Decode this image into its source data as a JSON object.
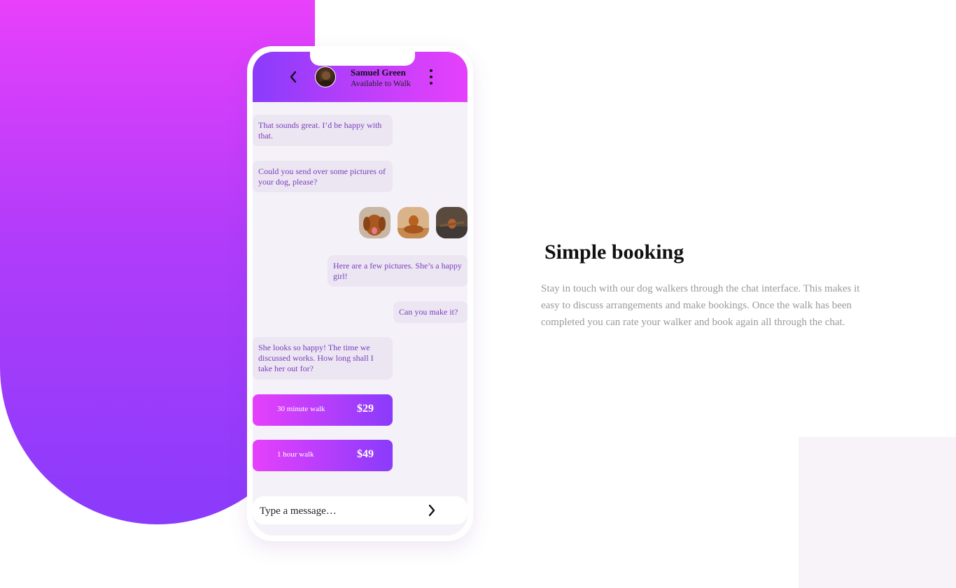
{
  "chat": {
    "contact": {
      "name": "Samuel Green",
      "status": "Available to Walk"
    },
    "messages": [
      {
        "from": "walker",
        "text": "That sounds great. I’d be happy with that."
      },
      {
        "from": "walker",
        "text": "Could you send over some pictures of your dog, please?"
      },
      {
        "from": "user",
        "type": "images",
        "count": 3
      },
      {
        "from": "user",
        "text": "Here are a few pictures. She’s a happy girl!"
      },
      {
        "from": "user",
        "text": "Can you make it?"
      },
      {
        "from": "walker",
        "text": "She looks so happy! The time we discussed works. How long shall I take her out for?"
      }
    ],
    "offers": [
      {
        "label": "30 minute walk",
        "price": "$29"
      },
      {
        "label": "1 hour walk",
        "price": "$49"
      }
    ],
    "input": {
      "placeholder": "Type a message…"
    },
    "icons": {
      "back": "chevron-left-icon",
      "more": "more-vertical-icon",
      "send": "chevron-right-icon"
    }
  },
  "feature": {
    "title": "Simple booking",
    "description": "Stay in touch with our dog walkers through the chat interface. This makes it easy to discuss arrangements and make bookings. Once the walk has been completed you can rate your walker and book again all through the chat."
  },
  "colors": {
    "gradient_start": "#e840fb",
    "gradient_end": "#8a3bfb",
    "bubble_bg": "#ece6f3",
    "bubble_text": "#7a3dbb"
  }
}
